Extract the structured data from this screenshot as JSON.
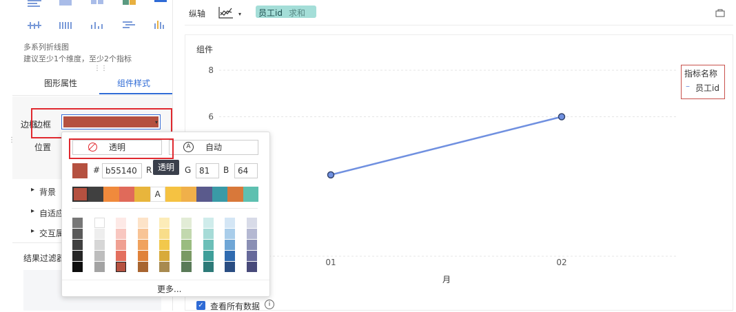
{
  "left_panel": {
    "chart_hint_title": "多系列折线图",
    "chart_hint_desc": "建议至少1个维度，至少2个指标",
    "tabs": [
      "图形属性",
      "组件样式"
    ],
    "border_label": "边框",
    "position_label": "位置",
    "tree_items": [
      "背景",
      "自适应",
      "交互属"
    ],
    "result_filter": "结果过滤器",
    "border_color": "#b55140"
  },
  "topbar": {
    "axis_label": "纵轴",
    "field_name": "员工id",
    "field_agg": "求和"
  },
  "chart_card": {
    "title": "组件",
    "show_all_label": "查看所有数据"
  },
  "chart_data": {
    "type": "line",
    "categories": [
      "01",
      "02"
    ],
    "series": [
      {
        "name": "员工id",
        "values": [
          3.5,
          6
        ]
      }
    ],
    "xlabel": "月",
    "ylabel": "",
    "ylim": [
      0,
      8
    ],
    "y_ticks": [
      "8",
      "6"
    ],
    "legend_title": "指标名称",
    "legend_position": "top-right",
    "grid": true,
    "line_color": "#7090e0"
  },
  "color_popup": {
    "transparent_label": "透明",
    "auto_label": "自动",
    "hash": "#",
    "hex_value": "b55140",
    "r_label": "R",
    "g_label": "G",
    "g_value": "81",
    "b_label": "B",
    "b_value": "64",
    "tooltip": "透明",
    "more_label": "更多...",
    "text_swatch_letter": "A",
    "selected_color": "#b55140",
    "theme_colors": [
      "#b55140",
      "#404040",
      "#f08a3c",
      "#e06a5a",
      "#e8b53c",
      "#ffffff",
      "#f5c242",
      "#f0b04a",
      "#5a5a8c",
      "#3a9aa6",
      "#d8783a",
      "#5ec0b0"
    ],
    "shade_columns": [
      [
        "#777777",
        "#5a5a5a",
        "#404040",
        "#262626",
        "#0d0d0d"
      ],
      [
        "#ffffff",
        "#eeeeee",
        "#d6d6d6",
        "#bdbdbd",
        "#a3a3a3"
      ],
      [
        "#fde9e6",
        "#f8c7c0",
        "#f0a092",
        "#e36f5e",
        "#b55140"
      ],
      [
        "#fde3c8",
        "#f8c496",
        "#f0a25e",
        "#e0823a",
        "#a86530"
      ],
      [
        "#fcecb8",
        "#f8dd8a",
        "#f2c84c",
        "#d8aa3a",
        "#a88a50"
      ],
      [
        "#e2ecd6",
        "#c2d8ae",
        "#9abc80",
        "#7a9a64",
        "#5a7a58"
      ],
      [
        "#cfeceb",
        "#a6dbd7",
        "#6cbfb8",
        "#3f9f9a",
        "#2d7a78"
      ],
      [
        "#d4e6f5",
        "#a9cdea",
        "#6fa6d6",
        "#2f6bb0",
        "#2a4d82"
      ],
      [
        "#d8dbe8",
        "#b4b8d2",
        "#8a8fb4",
        "#66699a",
        "#484a7a"
      ]
    ]
  }
}
